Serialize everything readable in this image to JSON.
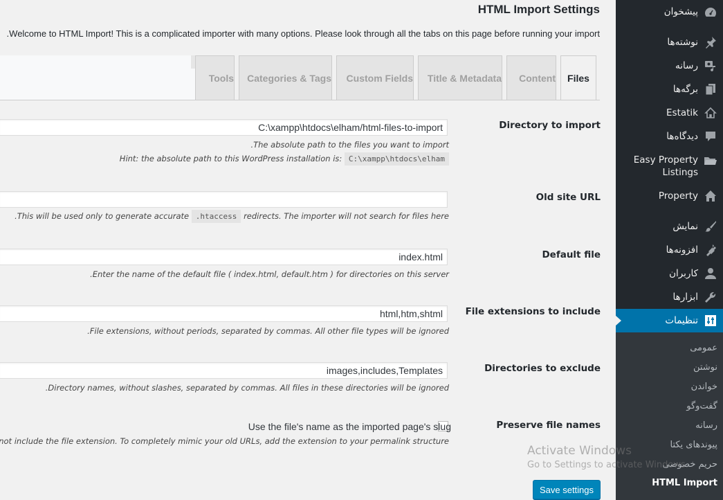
{
  "page": {
    "title": "HTML Import Settings",
    "intro": ".Welcome to HTML Import! This is a complicated importer with many options. Please look through all the tabs on this page before running your import"
  },
  "tabs": [
    {
      "label": "Files",
      "active": true
    },
    {
      "label": "Content",
      "active": false
    },
    {
      "label": "Title & Metadata",
      "active": false
    },
    {
      "label": "Custom Fields",
      "active": false
    },
    {
      "label": "Categories & Tags",
      "active": false
    },
    {
      "label": "Tools",
      "active": false
    }
  ],
  "fields": {
    "directory": {
      "label": "Directory to import",
      "value": "C:\\xampp\\htdocs\\elham/html-files-to-import",
      "desc": ".The absolute path to the files you want to import",
      "hint_prefix": "Hint: the absolute path to this WordPress installation is:",
      "hint_code": "C:\\xampp\\htdocs\\elham"
    },
    "old_url": {
      "label": "Old site URL",
      "value": "",
      "desc_before": ".This will be used only to generate accurate",
      "desc_code": ".htaccess",
      "desc_after": "redirects. The importer will not search for files here"
    },
    "default_file": {
      "label": "Default file",
      "value": "index.html",
      "desc": ".Enter the name of the default file ( index.html, default.htm ) for directories on this server"
    },
    "extensions": {
      "label": "File extensions to include",
      "value": "html,htm,shtml",
      "desc": ".File extensions, without periods, separated by commas. All other file types will be ignored"
    },
    "exclude": {
      "label": "Directories to exclude",
      "value": "images,includes,Templates",
      "desc": ".Directory names, without slashes, separated by commas. All files in these directories will be ignored"
    },
    "preserve": {
      "label": "Preserve file names",
      "checkbox_label": "Use the file's name as the imported page's slug",
      "checked": false,
      "desc": "not include the file extension. To completely mimic your old URLs, add the extension to your permalink structure"
    }
  },
  "save_button": "Save settings",
  "sidebar": {
    "items": [
      {
        "label": "پیشخوان",
        "icon": "dashboard-icon"
      },
      {
        "label": "نوشته‌ها",
        "icon": "pin-icon"
      },
      {
        "label": "رسانه",
        "icon": "media-icon"
      },
      {
        "label": "برگه‌ها",
        "icon": "pages-icon"
      },
      {
        "label": "Estatik",
        "icon": "home-icon"
      },
      {
        "label": "دیدگاه‌ها",
        "icon": "comment-icon"
      },
      {
        "label": "Easy Property Listings",
        "icon": "folder-icon"
      },
      {
        "label": "Property",
        "icon": "home-icon"
      },
      {
        "label": "نمایش",
        "icon": "brush-icon"
      },
      {
        "label": "افزونه‌ها",
        "icon": "plugin-icon"
      },
      {
        "label": "کاربران",
        "icon": "user-icon"
      },
      {
        "label": "ابزارها",
        "icon": "wrench-icon"
      },
      {
        "label": "تنظیمات",
        "icon": "settings-icon",
        "active": true
      }
    ],
    "submenu": [
      {
        "label": "عمومی"
      },
      {
        "label": "نوشتن"
      },
      {
        "label": "خواندن"
      },
      {
        "label": "گفت‌وگو"
      },
      {
        "label": "رسانه"
      },
      {
        "label": "پیوندهای یکتا"
      },
      {
        "label": "حریم خصوصی"
      },
      {
        "label": "HTML Import",
        "current": true
      }
    ]
  },
  "watermark": {
    "line1": "Activate Windows",
    "line2": "Go to Settings to activate Windows."
  },
  "colors": {
    "sidebar_bg": "#23282d",
    "submenu_bg": "#32373c",
    "accent": "#0073aa",
    "button": "#0085ba"
  }
}
